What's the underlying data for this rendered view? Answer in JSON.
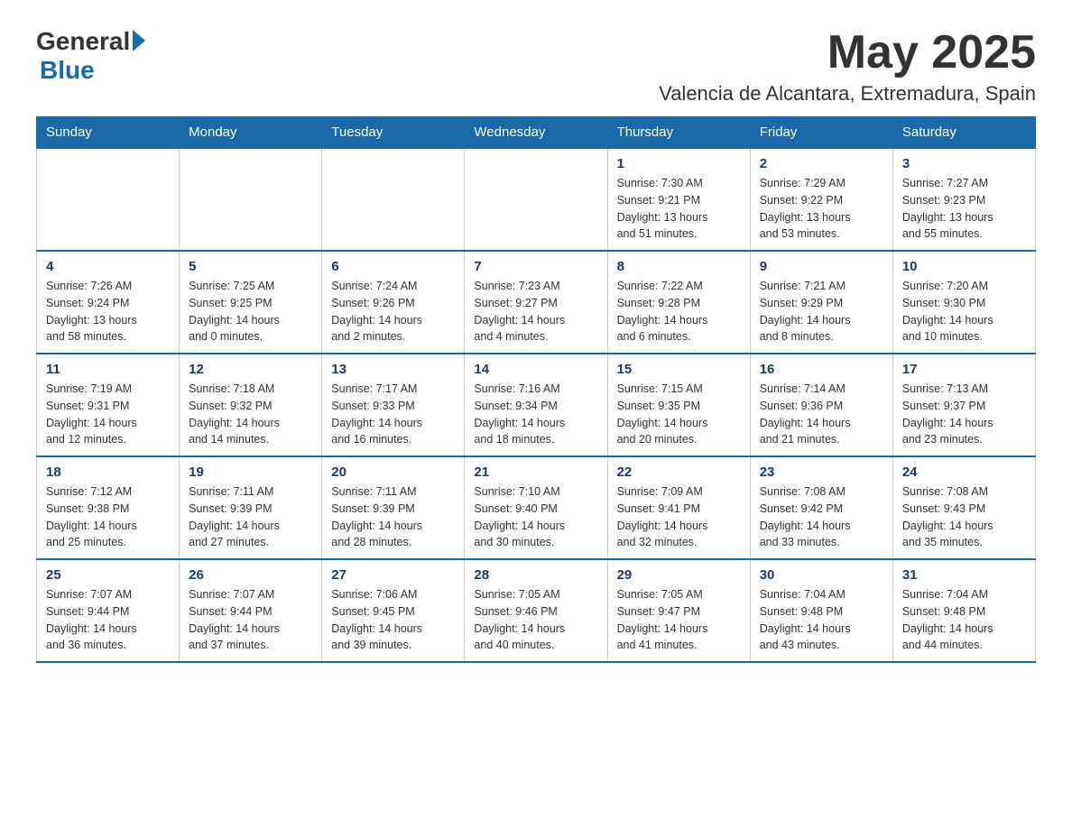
{
  "header": {
    "logo_general": "General",
    "logo_blue": "Blue",
    "month_title": "May 2025",
    "location": "Valencia de Alcantara, Extremadura, Spain"
  },
  "weekdays": [
    "Sunday",
    "Monday",
    "Tuesday",
    "Wednesday",
    "Thursday",
    "Friday",
    "Saturday"
  ],
  "weeks": [
    [
      {
        "day": "",
        "info": ""
      },
      {
        "day": "",
        "info": ""
      },
      {
        "day": "",
        "info": ""
      },
      {
        "day": "",
        "info": ""
      },
      {
        "day": "1",
        "info": "Sunrise: 7:30 AM\nSunset: 9:21 PM\nDaylight: 13 hours\nand 51 minutes."
      },
      {
        "day": "2",
        "info": "Sunrise: 7:29 AM\nSunset: 9:22 PM\nDaylight: 13 hours\nand 53 minutes."
      },
      {
        "day": "3",
        "info": "Sunrise: 7:27 AM\nSunset: 9:23 PM\nDaylight: 13 hours\nand 55 minutes."
      }
    ],
    [
      {
        "day": "4",
        "info": "Sunrise: 7:26 AM\nSunset: 9:24 PM\nDaylight: 13 hours\nand 58 minutes."
      },
      {
        "day": "5",
        "info": "Sunrise: 7:25 AM\nSunset: 9:25 PM\nDaylight: 14 hours\nand 0 minutes."
      },
      {
        "day": "6",
        "info": "Sunrise: 7:24 AM\nSunset: 9:26 PM\nDaylight: 14 hours\nand 2 minutes."
      },
      {
        "day": "7",
        "info": "Sunrise: 7:23 AM\nSunset: 9:27 PM\nDaylight: 14 hours\nand 4 minutes."
      },
      {
        "day": "8",
        "info": "Sunrise: 7:22 AM\nSunset: 9:28 PM\nDaylight: 14 hours\nand 6 minutes."
      },
      {
        "day": "9",
        "info": "Sunrise: 7:21 AM\nSunset: 9:29 PM\nDaylight: 14 hours\nand 8 minutes."
      },
      {
        "day": "10",
        "info": "Sunrise: 7:20 AM\nSunset: 9:30 PM\nDaylight: 14 hours\nand 10 minutes."
      }
    ],
    [
      {
        "day": "11",
        "info": "Sunrise: 7:19 AM\nSunset: 9:31 PM\nDaylight: 14 hours\nand 12 minutes."
      },
      {
        "day": "12",
        "info": "Sunrise: 7:18 AM\nSunset: 9:32 PM\nDaylight: 14 hours\nand 14 minutes."
      },
      {
        "day": "13",
        "info": "Sunrise: 7:17 AM\nSunset: 9:33 PM\nDaylight: 14 hours\nand 16 minutes."
      },
      {
        "day": "14",
        "info": "Sunrise: 7:16 AM\nSunset: 9:34 PM\nDaylight: 14 hours\nand 18 minutes."
      },
      {
        "day": "15",
        "info": "Sunrise: 7:15 AM\nSunset: 9:35 PM\nDaylight: 14 hours\nand 20 minutes."
      },
      {
        "day": "16",
        "info": "Sunrise: 7:14 AM\nSunset: 9:36 PM\nDaylight: 14 hours\nand 21 minutes."
      },
      {
        "day": "17",
        "info": "Sunrise: 7:13 AM\nSunset: 9:37 PM\nDaylight: 14 hours\nand 23 minutes."
      }
    ],
    [
      {
        "day": "18",
        "info": "Sunrise: 7:12 AM\nSunset: 9:38 PM\nDaylight: 14 hours\nand 25 minutes."
      },
      {
        "day": "19",
        "info": "Sunrise: 7:11 AM\nSunset: 9:39 PM\nDaylight: 14 hours\nand 27 minutes."
      },
      {
        "day": "20",
        "info": "Sunrise: 7:11 AM\nSunset: 9:39 PM\nDaylight: 14 hours\nand 28 minutes."
      },
      {
        "day": "21",
        "info": "Sunrise: 7:10 AM\nSunset: 9:40 PM\nDaylight: 14 hours\nand 30 minutes."
      },
      {
        "day": "22",
        "info": "Sunrise: 7:09 AM\nSunset: 9:41 PM\nDaylight: 14 hours\nand 32 minutes."
      },
      {
        "day": "23",
        "info": "Sunrise: 7:08 AM\nSunset: 9:42 PM\nDaylight: 14 hours\nand 33 minutes."
      },
      {
        "day": "24",
        "info": "Sunrise: 7:08 AM\nSunset: 9:43 PM\nDaylight: 14 hours\nand 35 minutes."
      }
    ],
    [
      {
        "day": "25",
        "info": "Sunrise: 7:07 AM\nSunset: 9:44 PM\nDaylight: 14 hours\nand 36 minutes."
      },
      {
        "day": "26",
        "info": "Sunrise: 7:07 AM\nSunset: 9:44 PM\nDaylight: 14 hours\nand 37 minutes."
      },
      {
        "day": "27",
        "info": "Sunrise: 7:06 AM\nSunset: 9:45 PM\nDaylight: 14 hours\nand 39 minutes."
      },
      {
        "day": "28",
        "info": "Sunrise: 7:05 AM\nSunset: 9:46 PM\nDaylight: 14 hours\nand 40 minutes."
      },
      {
        "day": "29",
        "info": "Sunrise: 7:05 AM\nSunset: 9:47 PM\nDaylight: 14 hours\nand 41 minutes."
      },
      {
        "day": "30",
        "info": "Sunrise: 7:04 AM\nSunset: 9:48 PM\nDaylight: 14 hours\nand 43 minutes."
      },
      {
        "day": "31",
        "info": "Sunrise: 7:04 AM\nSunset: 9:48 PM\nDaylight: 14 hours\nand 44 minutes."
      }
    ]
  ]
}
